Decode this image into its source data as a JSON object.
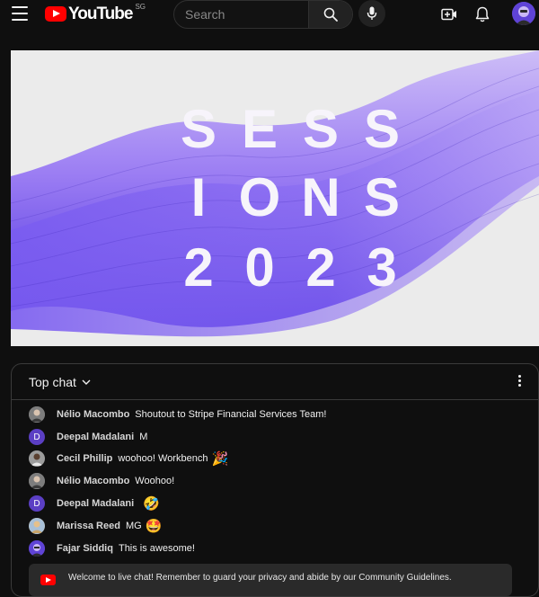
{
  "header": {
    "logo_text": "YouTube",
    "region": "SG",
    "search_placeholder": "Search"
  },
  "video": {
    "title_lines": [
      "SESS",
      "IONS",
      "2023"
    ]
  },
  "chat": {
    "header_label": "Top chat",
    "messages": [
      {
        "author": "Nélio Macombo",
        "text": "Shoutout to Stripe Financial Services Team!",
        "emoji": "",
        "avatar_initial": ""
      },
      {
        "author": "Deepal Madalani",
        "text": "M",
        "emoji": "",
        "avatar_initial": "D"
      },
      {
        "author": "Cecil Phillip",
        "text": "woohoo! Workbench",
        "emoji": "🎉",
        "avatar_initial": ""
      },
      {
        "author": "Nélio Macombo",
        "text": "Woohoo!",
        "emoji": "",
        "avatar_initial": ""
      },
      {
        "author": "Deepal Madalani",
        "text": "",
        "emoji": "🤣",
        "avatar_initial": "D"
      },
      {
        "author": "Marissa Reed",
        "text": "MG",
        "emoji": "🤩",
        "avatar_initial": ""
      },
      {
        "author": "Fajar Siddiq",
        "text": "This is awesome!",
        "emoji": "",
        "avatar_initial": ""
      }
    ],
    "welcome_text": "Welcome to live chat! Remember to guard your privacy and abide by our Community Guidelines."
  },
  "colors": {
    "accent_red": "#ff0000",
    "avatar_purple": "#5b3fc4",
    "wave_purple": "#6a4ff0"
  }
}
